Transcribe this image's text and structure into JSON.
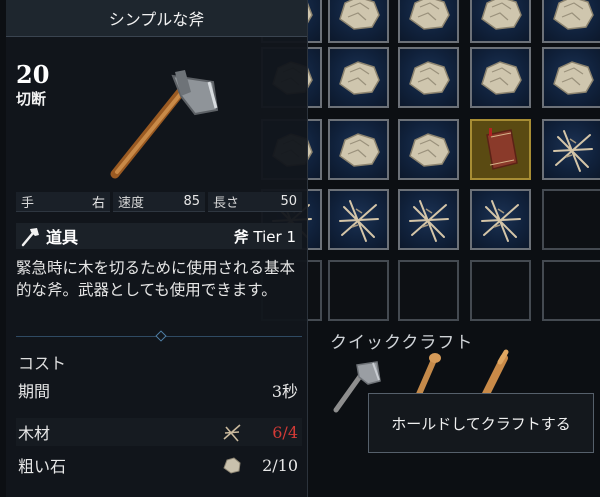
{
  "tooltip": {
    "title": "シンプルな斧",
    "damage_value": "20",
    "damage_type": "切断",
    "icon": "axe-icon",
    "stats": [
      {
        "label": "手",
        "value": "右"
      },
      {
        "label": "速度",
        "value": "85"
      },
      {
        "label": "長さ",
        "value": "50"
      }
    ],
    "type_label": "道具",
    "tier_prefix": "斧",
    "tier_text": "Tier 1",
    "description": "緊急時に木を切るために使用される基本的な斧。武器としても使用できます。",
    "cost_title": "コスト",
    "duration": {
      "label": "期間",
      "value": "3秒"
    },
    "costs": [
      {
        "label": "木材",
        "value": "6/4",
        "status": "insufficient",
        "icon": "wood-sticks-icon"
      },
      {
        "label": "粗い石",
        "value": "2/10",
        "status": "ok",
        "icon": "rough-stone-icon"
      }
    ]
  },
  "inventory": {
    "items": [
      "rough-stone-icon",
      "rough-stone-icon",
      "book-icon",
      "wood-sticks-icon"
    ]
  },
  "quick_craft": {
    "title": "クイッククラフト",
    "items": [
      "axe-icon",
      "club-icon",
      "torch-icon"
    ],
    "hold_hint": "ホールドしてクラフトする"
  },
  "colors": {
    "insufficient": "#d23a36",
    "slot_border": "#6c7178",
    "slot_bg": "#10213b",
    "highlight": "#a78d34"
  }
}
